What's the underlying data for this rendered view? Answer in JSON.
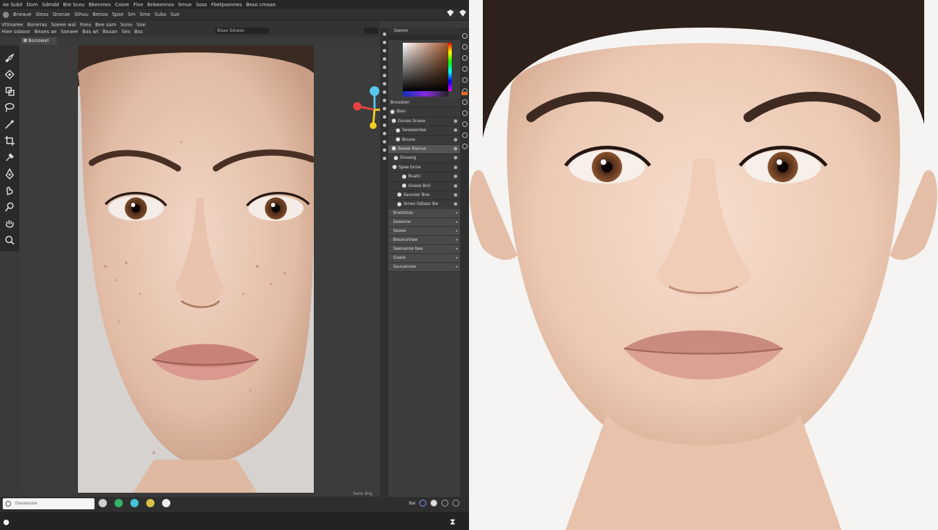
{
  "menu": {
    "items": [
      "Ae Subil",
      "Dom",
      "Sdmdd",
      "Bre Sceu",
      "Bkenmes",
      "Coore",
      "Flve",
      "Bnkeennos",
      "Smue",
      "Soss",
      "Fbetpsonnes",
      "Beso cmaan"
    ]
  },
  "toolbar": {
    "items": [
      "Bneaue",
      "Sleas",
      "Gronae",
      "Sthuu",
      "Benoa",
      "Spse",
      "Sm",
      "Sme",
      "Subs",
      "Sue"
    ]
  },
  "options": {
    "row1": [
      "Vtlinaree",
      "Boneras",
      "Soeee wal",
      "Foes",
      "Bee sam",
      "Sone",
      "Soe"
    ],
    "row2": [
      "Hiee sdaoor",
      "Beaes ae",
      "Sseaee",
      "Bas wt",
      "Bsuan",
      "Ses",
      "Bss"
    ],
    "pill": "Bisas Sduess"
  },
  "doc_tab": "Bonowel",
  "panel": {
    "title": "Sseme",
    "section": "Bnossten",
    "subsection": "Bien",
    "rows": [
      "Gunes Snaoe",
      "Seoasenlee",
      "Bnuoe",
      "Besee Bianue",
      "Snoasig",
      "Spee bnne",
      "Buatn",
      "Gnese Bnil",
      "Saunosr Bne",
      "Srneo Gdiass ibe"
    ],
    "section2": "Bnetsinss",
    "rows2": [
      "Saasone",
      "Seoee",
      "Besaiurinae",
      "Saenanne bee",
      "Siaaie",
      "Sauuanose"
    ]
  },
  "status": {
    "search_placeholder": "Dosassuse",
    "zoom": "Sans 4ng",
    "right_label": "Bai"
  },
  "colors": {
    "accent": "#e07a2a",
    "gizmo_x": "#e8423f",
    "gizmo_y": "#f0d020",
    "gizmo_z": "#59c6f0"
  }
}
